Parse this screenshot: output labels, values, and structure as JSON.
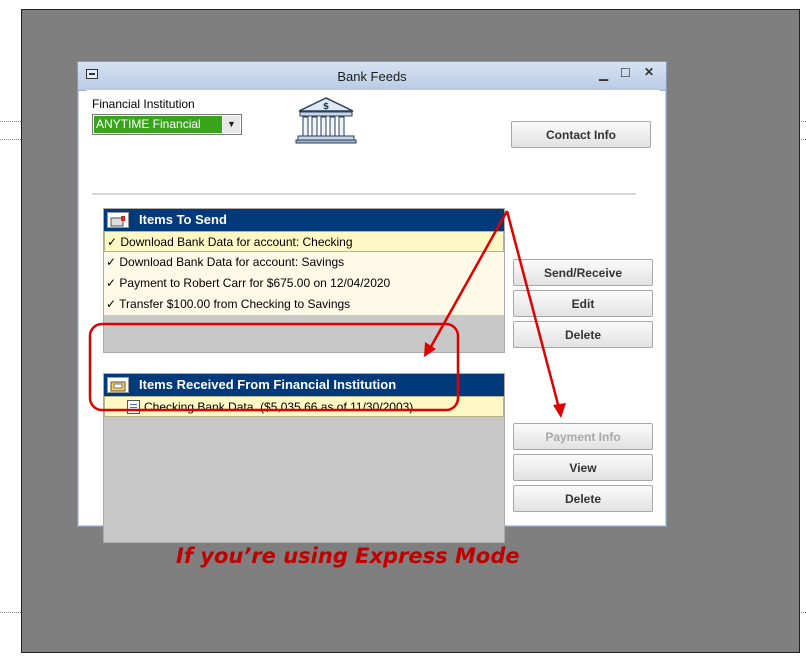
{
  "window": {
    "title": "Bank Feeds"
  },
  "financial_institution": {
    "label": "Financial Institution",
    "selected": "ANYTIME Financial"
  },
  "buttons": {
    "contact_info": "Contact Info",
    "send_receive": "Send/Receive",
    "edit": "Edit",
    "delete_send": "Delete",
    "payment_info": "Payment Info",
    "view": "View",
    "delete_received": "Delete"
  },
  "items_to_send": {
    "title": "Items To Send",
    "rows": [
      "✓ Download Bank Data for account: Checking",
      "✓ Download Bank Data for account: Savings",
      "✓ Payment to Robert Carr for $675.00 on 12/04/2020",
      "✓ Transfer $100.00 from Checking to Savings"
    ]
  },
  "items_received": {
    "title": "Items Received From Financial Institution",
    "rows": [
      "Checking Bank Data.  ($5,035.66 as of 11/30/2003)"
    ]
  },
  "caption": "If you’re using Express Mode",
  "colors": {
    "annotation": "#e00000",
    "panel_header": "#003a7a",
    "institution_highlight": "#3aa31d"
  }
}
